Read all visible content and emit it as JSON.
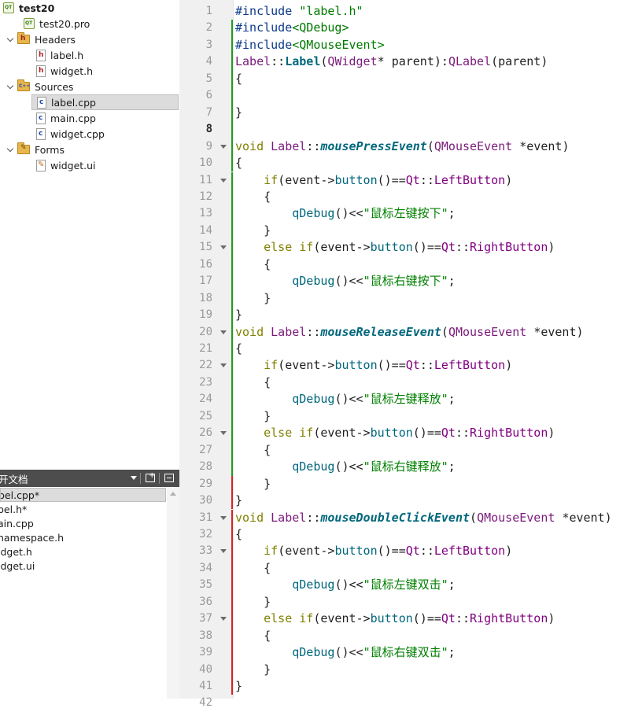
{
  "project_tree": {
    "project_name": "test20",
    "pro_file": "test20.pro",
    "headers_label": "Headers",
    "headers": [
      "label.h",
      "widget.h"
    ],
    "sources_label": "Sources",
    "sources": [
      "label.cpp",
      "main.cpp",
      "widget.cpp"
    ],
    "forms_label": "Forms",
    "forms": [
      "widget.ui"
    ],
    "selected": "label.cpp"
  },
  "open_documents": {
    "title": "打开文档",
    "title_visible": "开文档",
    "items": [
      "bel.cpp*",
      "bel.h*",
      "ain.cpp",
      "namespace.h",
      "idget.h",
      "idget.ui"
    ],
    "active_index": 0
  },
  "editor": {
    "first_line_number": 1,
    "current_line": 8,
    "lines": [
      [
        [
          "dir",
          "#include "
        ],
        [
          "strq",
          "\"label.h\""
        ]
      ],
      [
        [
          "dir",
          "#include"
        ],
        [
          "strq",
          "<QDebug>"
        ]
      ],
      [
        [
          "dir",
          "#include"
        ],
        [
          "strq",
          "<QMouseEvent>"
        ]
      ],
      [
        [
          "class",
          "Label"
        ],
        [
          "punct",
          "::"
        ],
        [
          "fnb",
          "Label"
        ],
        [
          "punct",
          "("
        ],
        [
          "class",
          "QWidget"
        ],
        [
          "punct",
          "* "
        ],
        [
          "var",
          "parent"
        ],
        [
          "punct",
          "):"
        ],
        [
          "class",
          "QLabel"
        ],
        [
          "punct",
          "("
        ],
        [
          "var",
          "parent"
        ],
        [
          "punct",
          ")"
        ]
      ],
      [
        [
          "punct",
          "{"
        ]
      ],
      [
        [
          "punct",
          ""
        ]
      ],
      [
        [
          "punct",
          "}"
        ]
      ],
      [
        [
          "punct",
          ""
        ]
      ],
      [
        [
          "kw2",
          "void "
        ],
        [
          "class",
          "Label"
        ],
        [
          "punct",
          "::"
        ],
        [
          "fni",
          "mousePressEvent"
        ],
        [
          "punct",
          "("
        ],
        [
          "class",
          "QMouseEvent "
        ],
        [
          "punct",
          "*"
        ],
        [
          "var",
          "event"
        ],
        [
          "punct",
          ")"
        ]
      ],
      [
        [
          "punct",
          "{"
        ]
      ],
      [
        [
          "punct",
          "    "
        ],
        [
          "kw2",
          "if"
        ],
        [
          "punct",
          "("
        ],
        [
          "var",
          "event"
        ],
        [
          "punct",
          "->"
        ],
        [
          "fn",
          "button"
        ],
        [
          "punct",
          "()=="
        ],
        [
          "ns",
          "Qt"
        ],
        [
          "punct",
          "::"
        ],
        [
          "enum",
          "LeftButton"
        ],
        [
          "punct",
          ")"
        ]
      ],
      [
        [
          "punct",
          "    {"
        ]
      ],
      [
        [
          "punct",
          "        "
        ],
        [
          "fn",
          "qDebug"
        ],
        [
          "punct",
          "()<<"
        ],
        [
          "str",
          "\"鼠标左键按下\""
        ],
        [
          "punct",
          ";"
        ]
      ],
      [
        [
          "punct",
          "    }"
        ]
      ],
      [
        [
          "punct",
          "    "
        ],
        [
          "kw2",
          "else if"
        ],
        [
          "punct",
          "("
        ],
        [
          "var",
          "event"
        ],
        [
          "punct",
          "->"
        ],
        [
          "fn",
          "button"
        ],
        [
          "punct",
          "()=="
        ],
        [
          "ns",
          "Qt"
        ],
        [
          "punct",
          "::"
        ],
        [
          "enum",
          "RightButton"
        ],
        [
          "punct",
          ")"
        ]
      ],
      [
        [
          "punct",
          "    {"
        ]
      ],
      [
        [
          "punct",
          "        "
        ],
        [
          "fn",
          "qDebug"
        ],
        [
          "punct",
          "()<<"
        ],
        [
          "str",
          "\"鼠标右键按下\""
        ],
        [
          "punct",
          ";"
        ]
      ],
      [
        [
          "punct",
          "    }"
        ]
      ],
      [
        [
          "punct",
          "}"
        ]
      ],
      [
        [
          "kw2",
          "void "
        ],
        [
          "class",
          "Label"
        ],
        [
          "punct",
          "::"
        ],
        [
          "fni",
          "mouseReleaseEvent"
        ],
        [
          "punct",
          "("
        ],
        [
          "class",
          "QMouseEvent "
        ],
        [
          "punct",
          "*"
        ],
        [
          "var",
          "event"
        ],
        [
          "punct",
          ")"
        ]
      ],
      [
        [
          "punct",
          "{"
        ]
      ],
      [
        [
          "punct",
          "    "
        ],
        [
          "kw2",
          "if"
        ],
        [
          "punct",
          "("
        ],
        [
          "var",
          "event"
        ],
        [
          "punct",
          "->"
        ],
        [
          "fn",
          "button"
        ],
        [
          "punct",
          "()=="
        ],
        [
          "ns",
          "Qt"
        ],
        [
          "punct",
          "::"
        ],
        [
          "enum",
          "LeftButton"
        ],
        [
          "punct",
          ")"
        ]
      ],
      [
        [
          "punct",
          "    {"
        ]
      ],
      [
        [
          "punct",
          "        "
        ],
        [
          "fn",
          "qDebug"
        ],
        [
          "punct",
          "()<<"
        ],
        [
          "str",
          "\"鼠标左键释放\""
        ],
        [
          "punct",
          ";"
        ]
      ],
      [
        [
          "punct",
          "    }"
        ]
      ],
      [
        [
          "punct",
          "    "
        ],
        [
          "kw2",
          "else if"
        ],
        [
          "punct",
          "("
        ],
        [
          "var",
          "event"
        ],
        [
          "punct",
          "->"
        ],
        [
          "fn",
          "button"
        ],
        [
          "punct",
          "()=="
        ],
        [
          "ns",
          "Qt"
        ],
        [
          "punct",
          "::"
        ],
        [
          "enum",
          "RightButton"
        ],
        [
          "punct",
          ")"
        ]
      ],
      [
        [
          "punct",
          "    {"
        ]
      ],
      [
        [
          "punct",
          "        "
        ],
        [
          "fn",
          "qDebug"
        ],
        [
          "punct",
          "()<<"
        ],
        [
          "str",
          "\"鼠标右键释放\""
        ],
        [
          "punct",
          ";"
        ]
      ],
      [
        [
          "punct",
          "    }"
        ]
      ],
      [
        [
          "punct",
          "}"
        ]
      ],
      [
        [
          "kw2",
          "void "
        ],
        [
          "class",
          "Label"
        ],
        [
          "punct",
          "::"
        ],
        [
          "fni",
          "mouseDoubleClickEvent"
        ],
        [
          "punct",
          "("
        ],
        [
          "class",
          "QMouseEvent "
        ],
        [
          "punct",
          "*"
        ],
        [
          "var",
          "event"
        ],
        [
          "punct",
          ")"
        ]
      ],
      [
        [
          "punct",
          "{"
        ]
      ],
      [
        [
          "punct",
          "    "
        ],
        [
          "kw2",
          "if"
        ],
        [
          "punct",
          "("
        ],
        [
          "var",
          "event"
        ],
        [
          "punct",
          "->"
        ],
        [
          "fn",
          "button"
        ],
        [
          "punct",
          "()=="
        ],
        [
          "ns",
          "Qt"
        ],
        [
          "punct",
          "::"
        ],
        [
          "enum",
          "LeftButton"
        ],
        [
          "punct",
          ")"
        ]
      ],
      [
        [
          "punct",
          "    {"
        ]
      ],
      [
        [
          "punct",
          "        "
        ],
        [
          "fn",
          "qDebug"
        ],
        [
          "punct",
          "()<<"
        ],
        [
          "str",
          "\"鼠标左键双击\""
        ],
        [
          "punct",
          ";"
        ]
      ],
      [
        [
          "punct",
          "    }"
        ]
      ],
      [
        [
          "punct",
          "    "
        ],
        [
          "kw2",
          "else if"
        ],
        [
          "punct",
          "("
        ],
        [
          "var",
          "event"
        ],
        [
          "punct",
          "->"
        ],
        [
          "fn",
          "button"
        ],
        [
          "punct",
          "()=="
        ],
        [
          "ns",
          "Qt"
        ],
        [
          "punct",
          "::"
        ],
        [
          "enum",
          "RightButton"
        ],
        [
          "punct",
          ")"
        ]
      ],
      [
        [
          "punct",
          "    {"
        ]
      ],
      [
        [
          "punct",
          "        "
        ],
        [
          "fn",
          "qDebug"
        ],
        [
          "punct",
          "()<<"
        ],
        [
          "str",
          "\"鼠标右键双击\""
        ],
        [
          "punct",
          ";"
        ]
      ],
      [
        [
          "punct",
          "    }"
        ]
      ],
      [
        [
          "punct",
          "}"
        ]
      ],
      [
        [
          "punct",
          ""
        ]
      ]
    ],
    "fold_marker_lines": [
      9,
      11,
      15,
      20,
      22,
      26,
      31,
      33,
      37
    ],
    "change_markers": {
      "saved_green": [
        2,
        3,
        4,
        5,
        6,
        7,
        8,
        9,
        10,
        11,
        12,
        13,
        14,
        15,
        16,
        17,
        18,
        19,
        20,
        21,
        22,
        23,
        24,
        25,
        26,
        27,
        28
      ],
      "unsaved_red": [
        29,
        30,
        31,
        32,
        33,
        34,
        35,
        36,
        37,
        38,
        39,
        40,
        41
      ]
    }
  },
  "colors": {
    "saved_marker": "#1e9e1e",
    "unsaved_marker": "#e02020",
    "gutter_bg": "#f0f0f0",
    "panel_header_bg": "#4d4d4d"
  }
}
